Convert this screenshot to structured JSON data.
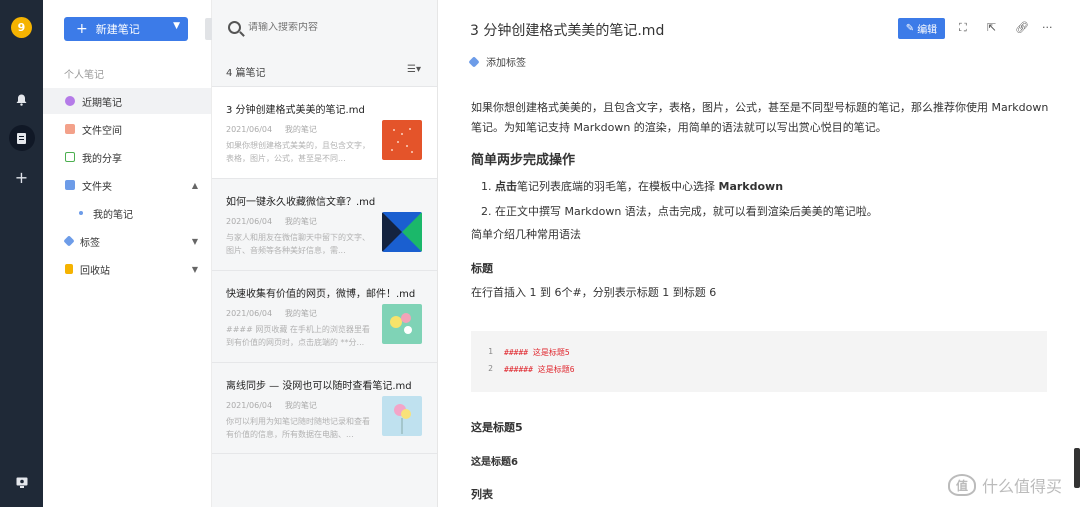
{
  "rail": {
    "avatar_text": "9"
  },
  "sidebar": {
    "new_note_label": "新建笔记",
    "section_label": "个人笔记",
    "items": [
      {
        "label": "近期笔记",
        "color": "#b57be8"
      },
      {
        "label": "文件空间",
        "color": "#f3a18a"
      },
      {
        "label": "我的分享",
        "color": "#4caf50"
      },
      {
        "label": "文件夹",
        "color": "#6d9ce8"
      },
      {
        "label": "我的笔记",
        "color": "#6d9ce8"
      },
      {
        "label": "标签",
        "color": "#6d9ce8"
      },
      {
        "label": "回收站",
        "color": "#f5b301"
      }
    ]
  },
  "notelist": {
    "search_placeholder": "请输入搜索内容",
    "count_label": "4 篇笔记",
    "notes": [
      {
        "title": "3 分钟创建格式美美的笔记.md",
        "date": "2021/06/04",
        "folder": "我的笔记",
        "excerpt": "如果你想创建格式美美的，且包含文字，表格，图片，公式，甚至是不同..."
      },
      {
        "title": "如何一键永久收藏微信文章？.md",
        "date": "2021/06/04",
        "folder": "我的笔记",
        "excerpt": "与家人和朋友在微信聊天中留下的文字、图片、音频等各种美好信息，需..."
      },
      {
        "title": "快速收集有价值的网页，微博，邮件！.md",
        "date": "2021/06/04",
        "folder": "我的笔记",
        "excerpt": "#### 网页收藏 在手机上的浏览器里看到有价值的网页时，点击底端的 **分..."
      },
      {
        "title": "离线同步 — 没网也可以随时查看笔记.md",
        "date": "2021/06/04",
        "folder": "我的笔记",
        "excerpt": "你可以利用为知笔记随时随地记录和查看有价值的信息，所有数据在电脑、..."
      }
    ]
  },
  "editor": {
    "title": "3 分钟创建格式美美的笔记.md",
    "edit_label": "编辑",
    "add_tag_label": "添加标签",
    "intro": "如果你想创建格式美美的，且包含文字，表格，图片，公式，甚至是不同型号标题的笔记，那么推荐你使用 Markdown 笔记。为知笔记支持 Markdown 的渲染，用简单的语法就可以写出赏心悦目的笔记。",
    "h_steps": "简单两步完成操作",
    "step1_bold": "点击",
    "step1_rest": "笔记列表底端的羽毛笔，在模板中心选择 ",
    "step1_bold2": "Markdown",
    "step2": "在正文中撰写 Markdown 语法，点击完成，就可以看到渲染后美美的笔记啦。",
    "intro2": "简单介绍几种常用语法",
    "h_title": "标题",
    "title_desc": "在行首插入 1 到 6个#，分别表示标题 1 到标题 6",
    "code_lines": [
      {
        "no": "1",
        "text": "##### 这是标题5"
      },
      {
        "no": "2",
        "text": "###### 这是标题6"
      }
    ],
    "h5_demo": "这是标题5",
    "h6_demo": "这是标题6",
    "h_list": "列表"
  },
  "watermark": {
    "text": "什么值得买",
    "logo": "值"
  }
}
